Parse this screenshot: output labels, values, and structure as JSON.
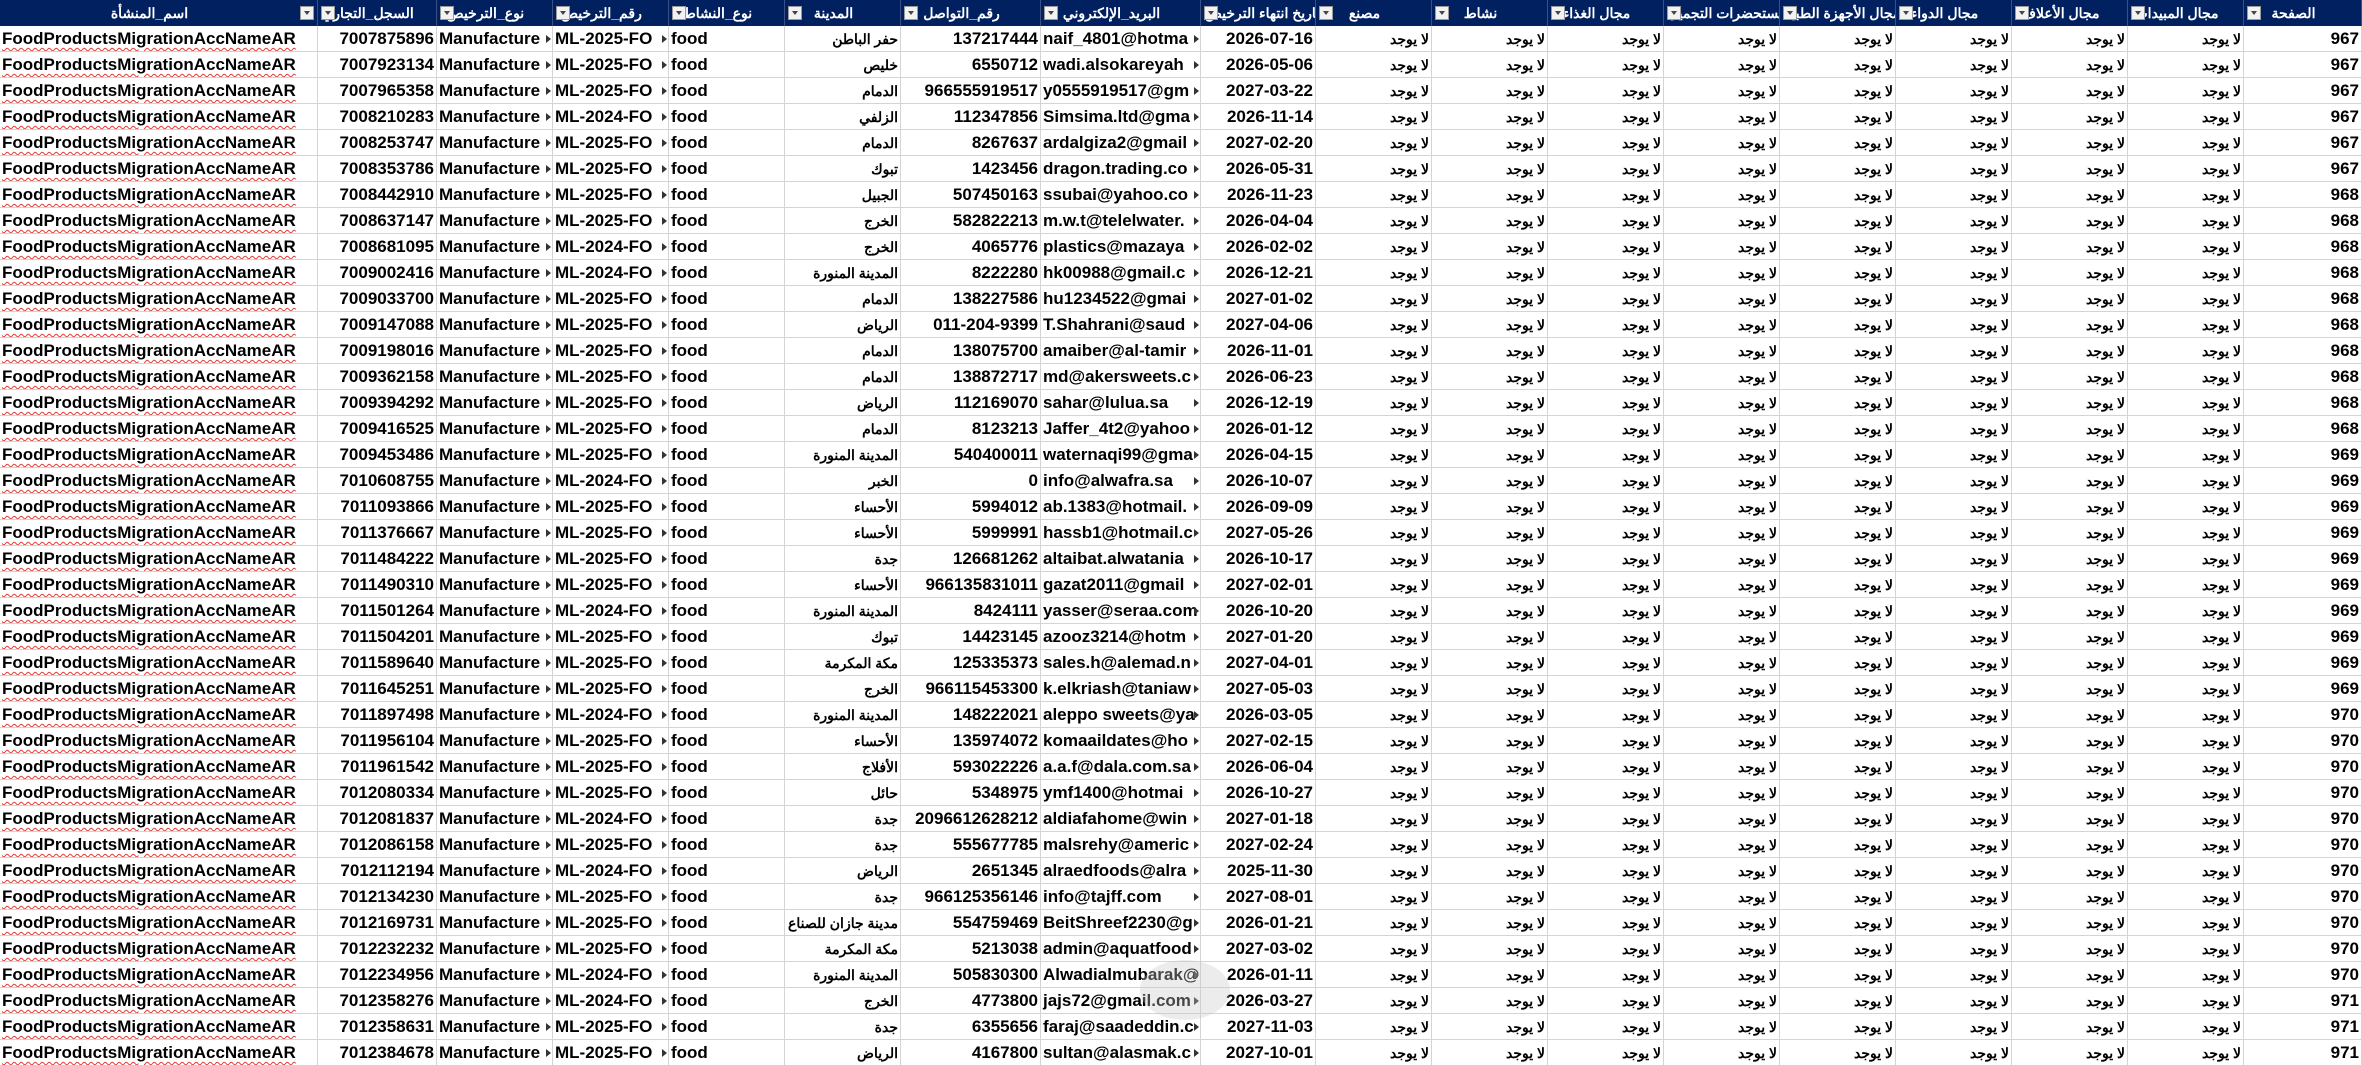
{
  "headers": {
    "name": "اسم_المنشأة",
    "cr": "السجل_التجاري",
    "license_type": "نوع_الترخيص",
    "license_no": "رقم_الترخيص",
    "activity_type": "نوع_النشاط",
    "city": "المدينة",
    "phone": "رقم_التواصل",
    "email": "البريد_الإلكتروني",
    "expiry": "تاريخ انتهاء الترخيص",
    "factory": "مصنع",
    "activity": "نشاط",
    "food_field": "مجال الغذاء",
    "cosmetics_field": "مجال مستحضرات التجميل",
    "medical_devices_field": "مجال الأجهزة الطبية",
    "drug_field": "مجال الدواء",
    "feed_field": "مجال الأعلاف",
    "pesticide_field": "مجال المبيدات",
    "page": "الصفحة"
  },
  "rows": [
    {
      "name": "FoodProductsMigrationAccNameAR",
      "cr": "7007875896",
      "lt": "Manufacture",
      "ln": "ML-2025-FO",
      "act": "food",
      "city": "حفر الباطن",
      "phone": "137217444",
      "email": "naif_4801@hotma",
      "exp": "2026-07-16",
      "f": "لا يوجد",
      "a": "لا يوجد",
      "fd": "لا يوجد",
      "cs": "لا يوجد",
      "md": "لا يوجد",
      "dr": "لا يوجد",
      "fe": "لا يوجد",
      "ps": "لا يوجد",
      "pg": "967"
    },
    {
      "name": "FoodProductsMigrationAccNameAR",
      "cr": "7007923134",
      "lt": "Manufacture",
      "ln": "ML-2025-FO",
      "act": "food",
      "city": "خليص",
      "phone": "6550712",
      "email": "wadi.alsokareyah",
      "exp": "2026-05-06",
      "f": "لا يوجد",
      "a": "لا يوجد",
      "fd": "لا يوجد",
      "cs": "لا يوجد",
      "md": "لا يوجد",
      "dr": "لا يوجد",
      "fe": "لا يوجد",
      "ps": "لا يوجد",
      "pg": "967"
    },
    {
      "name": "FoodProductsMigrationAccNameAR",
      "cr": "7007965358",
      "lt": "Manufacture",
      "ln": "ML-2025-FO",
      "act": "food",
      "city": "الدمام",
      "phone": "966555919517",
      "email": "y0555919517@gm",
      "exp": "2027-03-22",
      "f": "لا يوجد",
      "a": "لا يوجد",
      "fd": "لا يوجد",
      "cs": "لا يوجد",
      "md": "لا يوجد",
      "dr": "لا يوجد",
      "fe": "لا يوجد",
      "ps": "لا يوجد",
      "pg": "967"
    },
    {
      "name": "FoodProductsMigrationAccNameAR",
      "cr": "7008210283",
      "lt": "Manufacture",
      "ln": "ML-2024-FO",
      "act": "food",
      "city": "الزلفي",
      "phone": "112347856",
      "email": "Simsima.ltd@gma",
      "exp": "2026-11-14",
      "f": "لا يوجد",
      "a": "لا يوجد",
      "fd": "لا يوجد",
      "cs": "لا يوجد",
      "md": "لا يوجد",
      "dr": "لا يوجد",
      "fe": "لا يوجد",
      "ps": "لا يوجد",
      "pg": "967"
    },
    {
      "name": "FoodProductsMigrationAccNameAR",
      "cr": "7008253747",
      "lt": "Manufacture",
      "ln": "ML-2025-FO",
      "act": "food",
      "city": "الدمام",
      "phone": "8267637",
      "email": "ardalgiza2@gmail",
      "exp": "2027-02-20",
      "f": "لا يوجد",
      "a": "لا يوجد",
      "fd": "لا يوجد",
      "cs": "لا يوجد",
      "md": "لا يوجد",
      "dr": "لا يوجد",
      "fe": "لا يوجد",
      "ps": "لا يوجد",
      "pg": "967"
    },
    {
      "name": "FoodProductsMigrationAccNameAR",
      "cr": "7008353786",
      "lt": "Manufacture",
      "ln": "ML-2025-FO",
      "act": "food",
      "city": "تبوك",
      "phone": "1423456",
      "email": "dragon.trading.co",
      "exp": "2026-05-31",
      "f": "لا يوجد",
      "a": "لا يوجد",
      "fd": "لا يوجد",
      "cs": "لا يوجد",
      "md": "لا يوجد",
      "dr": "لا يوجد",
      "fe": "لا يوجد",
      "ps": "لا يوجد",
      "pg": "967"
    },
    {
      "name": "FoodProductsMigrationAccNameAR",
      "cr": "7008442910",
      "lt": "Manufacture",
      "ln": "ML-2025-FO",
      "act": "food",
      "city": "الجبيل",
      "phone": "507450163",
      "email": "ssubai@yahoo.co",
      "exp": "2026-11-23",
      "f": "لا يوجد",
      "a": "لا يوجد",
      "fd": "لا يوجد",
      "cs": "لا يوجد",
      "md": "لا يوجد",
      "dr": "لا يوجد",
      "fe": "لا يوجد",
      "ps": "لا يوجد",
      "pg": "968"
    },
    {
      "name": "FoodProductsMigrationAccNameAR",
      "cr": "7008637147",
      "lt": "Manufacture",
      "ln": "ML-2025-FO",
      "act": "food",
      "city": "الخرج",
      "phone": "582822213",
      "email": "m.w.t@telelwater.",
      "exp": "2026-04-04",
      "f": "لا يوجد",
      "a": "لا يوجد",
      "fd": "لا يوجد",
      "cs": "لا يوجد",
      "md": "لا يوجد",
      "dr": "لا يوجد",
      "fe": "لا يوجد",
      "ps": "لا يوجد",
      "pg": "968"
    },
    {
      "name": "FoodProductsMigrationAccNameAR",
      "cr": "7008681095",
      "lt": "Manufacture",
      "ln": "ML-2024-FO",
      "act": "food",
      "city": "الخرج",
      "phone": "4065776",
      "email": "plastics@mazaya",
      "exp": "2026-02-02",
      "f": "لا يوجد",
      "a": "لا يوجد",
      "fd": "لا يوجد",
      "cs": "لا يوجد",
      "md": "لا يوجد",
      "dr": "لا يوجد",
      "fe": "لا يوجد",
      "ps": "لا يوجد",
      "pg": "968"
    },
    {
      "name": "FoodProductsMigrationAccNameAR",
      "cr": "7009002416",
      "lt": "Manufacture",
      "ln": "ML-2024-FO",
      "act": "food",
      "city": "المدينة المنورة",
      "phone": "8222280",
      "email": "hk00988@gmail.c",
      "exp": "2026-12-21",
      "f": "لا يوجد",
      "a": "لا يوجد",
      "fd": "لا يوجد",
      "cs": "لا يوجد",
      "md": "لا يوجد",
      "dr": "لا يوجد",
      "fe": "لا يوجد",
      "ps": "لا يوجد",
      "pg": "968"
    },
    {
      "name": "FoodProductsMigrationAccNameAR",
      "cr": "7009033700",
      "lt": "Manufacture",
      "ln": "ML-2025-FO",
      "act": "food",
      "city": "الدمام",
      "phone": "138227586",
      "email": "hu1234522@gmai",
      "exp": "2027-01-02",
      "f": "لا يوجد",
      "a": "لا يوجد",
      "fd": "لا يوجد",
      "cs": "لا يوجد",
      "md": "لا يوجد",
      "dr": "لا يوجد",
      "fe": "لا يوجد",
      "ps": "لا يوجد",
      "pg": "968"
    },
    {
      "name": "FoodProductsMigrationAccNameAR",
      "cr": "7009147088",
      "lt": "Manufacture",
      "ln": "ML-2025-FO",
      "act": "food",
      "city": "الرياض",
      "phone": "011-204-9399",
      "email": "T.Shahrani@saud",
      "exp": "2027-04-06",
      "f": "لا يوجد",
      "a": "لا يوجد",
      "fd": "لا يوجد",
      "cs": "لا يوجد",
      "md": "لا يوجد",
      "dr": "لا يوجد",
      "fe": "لا يوجد",
      "ps": "لا يوجد",
      "pg": "968"
    },
    {
      "name": "FoodProductsMigrationAccNameAR",
      "cr": "7009198016",
      "lt": "Manufacture",
      "ln": "ML-2025-FO",
      "act": "food",
      "city": "الدمام",
      "phone": "138075700",
      "email": "amaiber@al-tamir",
      "exp": "2026-11-01",
      "f": "لا يوجد",
      "a": "لا يوجد",
      "fd": "لا يوجد",
      "cs": "لا يوجد",
      "md": "لا يوجد",
      "dr": "لا يوجد",
      "fe": "لا يوجد",
      "ps": "لا يوجد",
      "pg": "968"
    },
    {
      "name": "FoodProductsMigrationAccNameAR",
      "cr": "7009362158",
      "lt": "Manufacture",
      "ln": "ML-2025-FO",
      "act": "food",
      "city": "الدمام",
      "phone": "138872717",
      "email": "md@akersweets.c",
      "exp": "2026-06-23",
      "f": "لا يوجد",
      "a": "لا يوجد",
      "fd": "لا يوجد",
      "cs": "لا يوجد",
      "md": "لا يوجد",
      "dr": "لا يوجد",
      "fe": "لا يوجد",
      "ps": "لا يوجد",
      "pg": "968"
    },
    {
      "name": "FoodProductsMigrationAccNameAR",
      "cr": "7009394292",
      "lt": "Manufacture",
      "ln": "ML-2025-FO",
      "act": "food",
      "city": "الرياض",
      "phone": "112169070",
      "email": "sahar@lulua.sa",
      "exp": "2026-12-19",
      "f": "لا يوجد",
      "a": "لا يوجد",
      "fd": "لا يوجد",
      "cs": "لا يوجد",
      "md": "لا يوجد",
      "dr": "لا يوجد",
      "fe": "لا يوجد",
      "ps": "لا يوجد",
      "pg": "968"
    },
    {
      "name": "FoodProductsMigrationAccNameAR",
      "cr": "7009416525",
      "lt": "Manufacture",
      "ln": "ML-2025-FO",
      "act": "food",
      "city": "الدمام",
      "phone": "8123213",
      "email": "Jaffer_4t2@yahoo",
      "exp": "2026-01-12",
      "f": "لا يوجد",
      "a": "لا يوجد",
      "fd": "لا يوجد",
      "cs": "لا يوجد",
      "md": "لا يوجد",
      "dr": "لا يوجد",
      "fe": "لا يوجد",
      "ps": "لا يوجد",
      "pg": "968"
    },
    {
      "name": "FoodProductsMigrationAccNameAR",
      "cr": "7009453486",
      "lt": "Manufacture",
      "ln": "ML-2025-FO",
      "act": "food",
      "city": "المدينة المنورة",
      "phone": "540400011",
      "email": "waternaqi99@gma",
      "exp": "2026-04-15",
      "f": "لا يوجد",
      "a": "لا يوجد",
      "fd": "لا يوجد",
      "cs": "لا يوجد",
      "md": "لا يوجد",
      "dr": "لا يوجد",
      "fe": "لا يوجد",
      "ps": "لا يوجد",
      "pg": "969"
    },
    {
      "name": "FoodProductsMigrationAccNameAR",
      "cr": "7010608755",
      "lt": "Manufacture",
      "ln": "ML-2024-FO",
      "act": "food",
      "city": "الخبر",
      "phone": "0",
      "email": "info@alwafra.sa",
      "exp": "2026-10-07",
      "f": "لا يوجد",
      "a": "لا يوجد",
      "fd": "لا يوجد",
      "cs": "لا يوجد",
      "md": "لا يوجد",
      "dr": "لا يوجد",
      "fe": "لا يوجد",
      "ps": "لا يوجد",
      "pg": "969"
    },
    {
      "name": "FoodProductsMigrationAccNameAR",
      "cr": "7011093866",
      "lt": "Manufacture",
      "ln": "ML-2025-FO",
      "act": "food",
      "city": "الأحساء",
      "phone": "5994012",
      "email": "ab.1383@hotmail.",
      "exp": "2026-09-09",
      "f": "لا يوجد",
      "a": "لا يوجد",
      "fd": "لا يوجد",
      "cs": "لا يوجد",
      "md": "لا يوجد",
      "dr": "لا يوجد",
      "fe": "لا يوجد",
      "ps": "لا يوجد",
      "pg": "969"
    },
    {
      "name": "FoodProductsMigrationAccNameAR",
      "cr": "7011376667",
      "lt": "Manufacture",
      "ln": "ML-2025-FO",
      "act": "food",
      "city": "الأحساء",
      "phone": "5999991",
      "email": "hassb1@hotmail.c",
      "exp": "2027-05-26",
      "f": "لا يوجد",
      "a": "لا يوجد",
      "fd": "لا يوجد",
      "cs": "لا يوجد",
      "md": "لا يوجد",
      "dr": "لا يوجد",
      "fe": "لا يوجد",
      "ps": "لا يوجد",
      "pg": "969"
    },
    {
      "name": "FoodProductsMigrationAccNameAR",
      "cr": "7011484222",
      "lt": "Manufacture",
      "ln": "ML-2025-FO",
      "act": "food",
      "city": "جدة",
      "phone": "126681262",
      "email": "altaibat.alwatania",
      "exp": "2026-10-17",
      "f": "لا يوجد",
      "a": "لا يوجد",
      "fd": "لا يوجد",
      "cs": "لا يوجد",
      "md": "لا يوجد",
      "dr": "لا يوجد",
      "fe": "لا يوجد",
      "ps": "لا يوجد",
      "pg": "969"
    },
    {
      "name": "FoodProductsMigrationAccNameAR",
      "cr": "7011490310",
      "lt": "Manufacture",
      "ln": "ML-2025-FO",
      "act": "food",
      "city": "الأحساء",
      "phone": "966135831011",
      "email": "gazat2011@gmail",
      "exp": "2027-02-01",
      "f": "لا يوجد",
      "a": "لا يوجد",
      "fd": "لا يوجد",
      "cs": "لا يوجد",
      "md": "لا يوجد",
      "dr": "لا يوجد",
      "fe": "لا يوجد",
      "ps": "لا يوجد",
      "pg": "969"
    },
    {
      "name": "FoodProductsMigrationAccNameAR",
      "cr": "7011501264",
      "lt": "Manufacture",
      "ln": "ML-2024-FO",
      "act": "food",
      "city": "المدينة المنورة",
      "phone": "8424111",
      "email": "yasser@seraa.com",
      "exp": "2026-10-20",
      "f": "لا يوجد",
      "a": "لا يوجد",
      "fd": "لا يوجد",
      "cs": "لا يوجد",
      "md": "لا يوجد",
      "dr": "لا يوجد",
      "fe": "لا يوجد",
      "ps": "لا يوجد",
      "pg": "969"
    },
    {
      "name": "FoodProductsMigrationAccNameAR",
      "cr": "7011504201",
      "lt": "Manufacture",
      "ln": "ML-2025-FO",
      "act": "food",
      "city": "تبوك",
      "phone": "14423145",
      "email": "azooz3214@hotm",
      "exp": "2027-01-20",
      "f": "لا يوجد",
      "a": "لا يوجد",
      "fd": "لا يوجد",
      "cs": "لا يوجد",
      "md": "لا يوجد",
      "dr": "لا يوجد",
      "fe": "لا يوجد",
      "ps": "لا يوجد",
      "pg": "969"
    },
    {
      "name": "FoodProductsMigrationAccNameAR",
      "cr": "7011589640",
      "lt": "Manufacture",
      "ln": "ML-2025-FO",
      "act": "food",
      "city": "مكة المكرمة",
      "phone": "125335373",
      "email": "sales.h@alemad.n",
      "exp": "2027-04-01",
      "f": "لا يوجد",
      "a": "لا يوجد",
      "fd": "لا يوجد",
      "cs": "لا يوجد",
      "md": "لا يوجد",
      "dr": "لا يوجد",
      "fe": "لا يوجد",
      "ps": "لا يوجد",
      "pg": "969"
    },
    {
      "name": "FoodProductsMigrationAccNameAR",
      "cr": "7011645251",
      "lt": "Manufacture",
      "ln": "ML-2025-FO",
      "act": "food",
      "city": "الخرج",
      "phone": "966115453300",
      "email": "k.elkriash@taniaw",
      "exp": "2027-05-03",
      "f": "لا يوجد",
      "a": "لا يوجد",
      "fd": "لا يوجد",
      "cs": "لا يوجد",
      "md": "لا يوجد",
      "dr": "لا يوجد",
      "fe": "لا يوجد",
      "ps": "لا يوجد",
      "pg": "969"
    },
    {
      "name": "FoodProductsMigrationAccNameAR",
      "cr": "7011897498",
      "lt": "Manufacture",
      "ln": "ML-2024-FO",
      "act": "food",
      "city": "المدينة المنورة",
      "phone": "148222021",
      "email": "aleppo sweets@ya",
      "exp": "2026-03-05",
      "f": "لا يوجد",
      "a": "لا يوجد",
      "fd": "لا يوجد",
      "cs": "لا يوجد",
      "md": "لا يوجد",
      "dr": "لا يوجد",
      "fe": "لا يوجد",
      "ps": "لا يوجد",
      "pg": "970"
    },
    {
      "name": "FoodProductsMigrationAccNameAR",
      "cr": "7011956104",
      "lt": "Manufacture",
      "ln": "ML-2025-FO",
      "act": "food",
      "city": "الأحساء",
      "phone": "135974072",
      "email": "komaaildates@ho",
      "exp": "2027-02-15",
      "f": "لا يوجد",
      "a": "لا يوجد",
      "fd": "لا يوجد",
      "cs": "لا يوجد",
      "md": "لا يوجد",
      "dr": "لا يوجد",
      "fe": "لا يوجد",
      "ps": "لا يوجد",
      "pg": "970"
    },
    {
      "name": "FoodProductsMigrationAccNameAR",
      "cr": "7011961542",
      "lt": "Manufacture",
      "ln": "ML-2025-FO",
      "act": "food",
      "city": "الأفلاج",
      "phone": "593022226",
      "email": "a.a.f@dala.com.sa",
      "exp": "2026-06-04",
      "f": "لا يوجد",
      "a": "لا يوجد",
      "fd": "لا يوجد",
      "cs": "لا يوجد",
      "md": "لا يوجد",
      "dr": "لا يوجد",
      "fe": "لا يوجد",
      "ps": "لا يوجد",
      "pg": "970"
    },
    {
      "name": "FoodProductsMigrationAccNameAR",
      "cr": "7012080334",
      "lt": "Manufacture",
      "ln": "ML-2025-FO",
      "act": "food",
      "city": "حائل",
      "phone": "5348975",
      "email": "ymf1400@hotmai",
      "exp": "2026-10-27",
      "f": "لا يوجد",
      "a": "لا يوجد",
      "fd": "لا يوجد",
      "cs": "لا يوجد",
      "md": "لا يوجد",
      "dr": "لا يوجد",
      "fe": "لا يوجد",
      "ps": "لا يوجد",
      "pg": "970"
    },
    {
      "name": "FoodProductsMigrationAccNameAR",
      "cr": "7012081837",
      "lt": "Manufacture",
      "ln": "ML-2024-FO",
      "act": "food",
      "city": "جدة",
      "phone": "2096612628212",
      "email": "aldiafahome@win",
      "exp": "2027-01-18",
      "f": "لا يوجد",
      "a": "لا يوجد",
      "fd": "لا يوجد",
      "cs": "لا يوجد",
      "md": "لا يوجد",
      "dr": "لا يوجد",
      "fe": "لا يوجد",
      "ps": "لا يوجد",
      "pg": "970"
    },
    {
      "name": "FoodProductsMigrationAccNameAR",
      "cr": "7012086158",
      "lt": "Manufacture",
      "ln": "ML-2025-FO",
      "act": "food",
      "city": "جدة",
      "phone": "555677785",
      "email": "malsrehy@americ",
      "exp": "2027-02-24",
      "f": "لا يوجد",
      "a": "لا يوجد",
      "fd": "لا يوجد",
      "cs": "لا يوجد",
      "md": "لا يوجد",
      "dr": "لا يوجد",
      "fe": "لا يوجد",
      "ps": "لا يوجد",
      "pg": "970"
    },
    {
      "name": "FoodProductsMigrationAccNameAR",
      "cr": "7012112194",
      "lt": "Manufacture",
      "ln": "ML-2024-FO",
      "act": "food",
      "city": "الرياض",
      "phone": "2651345",
      "email": "alraedfoods@alra",
      "exp": "2025-11-30",
      "f": "لا يوجد",
      "a": "لا يوجد",
      "fd": "لا يوجد",
      "cs": "لا يوجد",
      "md": "لا يوجد",
      "dr": "لا يوجد",
      "fe": "لا يوجد",
      "ps": "لا يوجد",
      "pg": "970"
    },
    {
      "name": "FoodProductsMigrationAccNameAR",
      "cr": "7012134230",
      "lt": "Manufacture",
      "ln": "ML-2025-FO",
      "act": "food",
      "city": "جدة",
      "phone": "966125356146",
      "email": "info@tajff.com",
      "exp": "2027-08-01",
      "f": "لا يوجد",
      "a": "لا يوجد",
      "fd": "لا يوجد",
      "cs": "لا يوجد",
      "md": "لا يوجد",
      "dr": "لا يوجد",
      "fe": "لا يوجد",
      "ps": "لا يوجد",
      "pg": "970"
    },
    {
      "name": "FoodProductsMigrationAccNameAR",
      "cr": "7012169731",
      "lt": "Manufacture",
      "ln": "ML-2025-FO",
      "act": "food",
      "city": "مدينة جازان للصناع",
      "phone": "554759469",
      "email": "BeitShreef2230@g",
      "exp": "2026-01-21",
      "f": "لا يوجد",
      "a": "لا يوجد",
      "fd": "لا يوجد",
      "cs": "لا يوجد",
      "md": "لا يوجد",
      "dr": "لا يوجد",
      "fe": "لا يوجد",
      "ps": "لا يوجد",
      "pg": "970"
    },
    {
      "name": "FoodProductsMigrationAccNameAR",
      "cr": "7012232232",
      "lt": "Manufacture",
      "ln": "ML-2025-FO",
      "act": "food",
      "city": "مكة المكرمة",
      "phone": "5213038",
      "email": "admin@aquatfood",
      "exp": "2027-03-02",
      "f": "لا يوجد",
      "a": "لا يوجد",
      "fd": "لا يوجد",
      "cs": "لا يوجد",
      "md": "لا يوجد",
      "dr": "لا يوجد",
      "fe": "لا يوجد",
      "ps": "لا يوجد",
      "pg": "970"
    },
    {
      "name": "FoodProductsMigrationAccNameAR",
      "cr": "7012234956",
      "lt": "Manufacture",
      "ln": "ML-2024-FO",
      "act": "food",
      "city": "المدينة المنورة",
      "phone": "505830300",
      "email": "Alwadialmubarak@",
      "exp": "2026-01-11",
      "f": "لا يوجد",
      "a": "لا يوجد",
      "fd": "لا يوجد",
      "cs": "لا يوجد",
      "md": "لا يوجد",
      "dr": "لا يوجد",
      "fe": "لا يوجد",
      "ps": "لا يوجد",
      "pg": "970"
    },
    {
      "name": "FoodProductsMigrationAccNameAR",
      "cr": "7012358276",
      "lt": "Manufacture",
      "ln": "ML-2024-FO",
      "act": "food",
      "city": "الخرج",
      "phone": "4773800",
      "email": "jajs72@gmail.com",
      "exp": "2026-03-27",
      "f": "لا يوجد",
      "a": "لا يوجد",
      "fd": "لا يوجد",
      "cs": "لا يوجد",
      "md": "لا يوجد",
      "dr": "لا يوجد",
      "fe": "لا يوجد",
      "ps": "لا يوجد",
      "pg": "971"
    },
    {
      "name": "FoodProductsMigrationAccNameAR",
      "cr": "7012358631",
      "lt": "Manufacture",
      "ln": "ML-2025-FO",
      "act": "food",
      "city": "جدة",
      "phone": "6355656",
      "email": "faraj@saadeddin.c",
      "exp": "2027-11-03",
      "f": "لا يوجد",
      "a": "لا يوجد",
      "fd": "لا يوجد",
      "cs": "لا يوجد",
      "md": "لا يوجد",
      "dr": "لا يوجد",
      "fe": "لا يوجد",
      "ps": "لا يوجد",
      "pg": "971"
    },
    {
      "name": "FoodProductsMigrationAccNameAR",
      "cr": "7012384678",
      "lt": "Manufacture",
      "ln": "ML-2025-FO",
      "act": "food",
      "city": "الرياض",
      "phone": "4167800",
      "email": "sultan@alasmak.c",
      "exp": "2027-10-01",
      "f": "لا يوجد",
      "a": "لا يوجد",
      "fd": "لا يوجد",
      "cs": "لا يوجد",
      "md": "لا يوجد",
      "dr": "لا يوجد",
      "fe": "لا يوجد",
      "ps": "لا يوجد",
      "pg": "971"
    }
  ],
  "colors": {
    "header_bg": "#002060",
    "header_text": "#ffffff",
    "gridline": "#d4d4d4"
  }
}
